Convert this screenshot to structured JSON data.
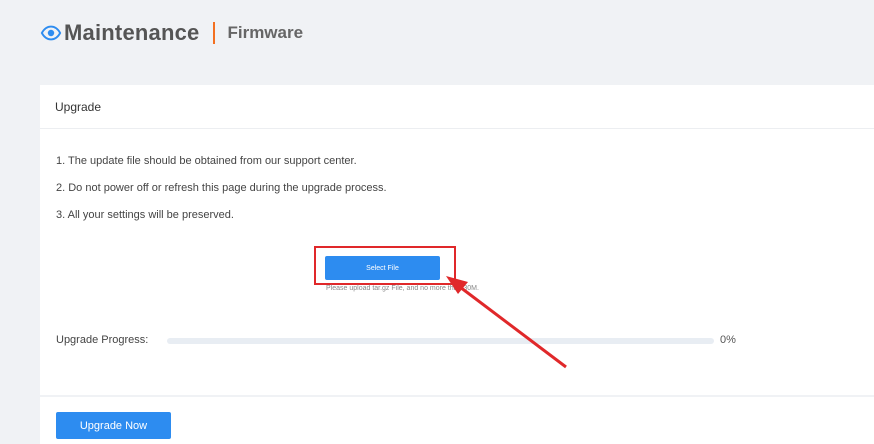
{
  "header": {
    "icon": "eye-icon",
    "title": "Maintenance",
    "subtitle": "Firmware",
    "accent_color": "#f37021",
    "icon_color": "#2d8cf0"
  },
  "card": {
    "title": "Upgrade",
    "instructions": [
      "1. The update file should be obtained from our support center.",
      "2. Do not power off or refresh this page during the upgrade process.",
      "3. All your settings will be preserved."
    ],
    "select_file_label": "Select File",
    "hint": "Please upload tar.gz File, and no more than 30M.",
    "highlight_color": "#e0282a",
    "progress": {
      "label": "Upgrade Progress:",
      "value": 0,
      "value_text": "0%"
    }
  },
  "footer": {
    "upgrade_now_label": "Upgrade Now",
    "button_color": "#2d8cf0"
  }
}
